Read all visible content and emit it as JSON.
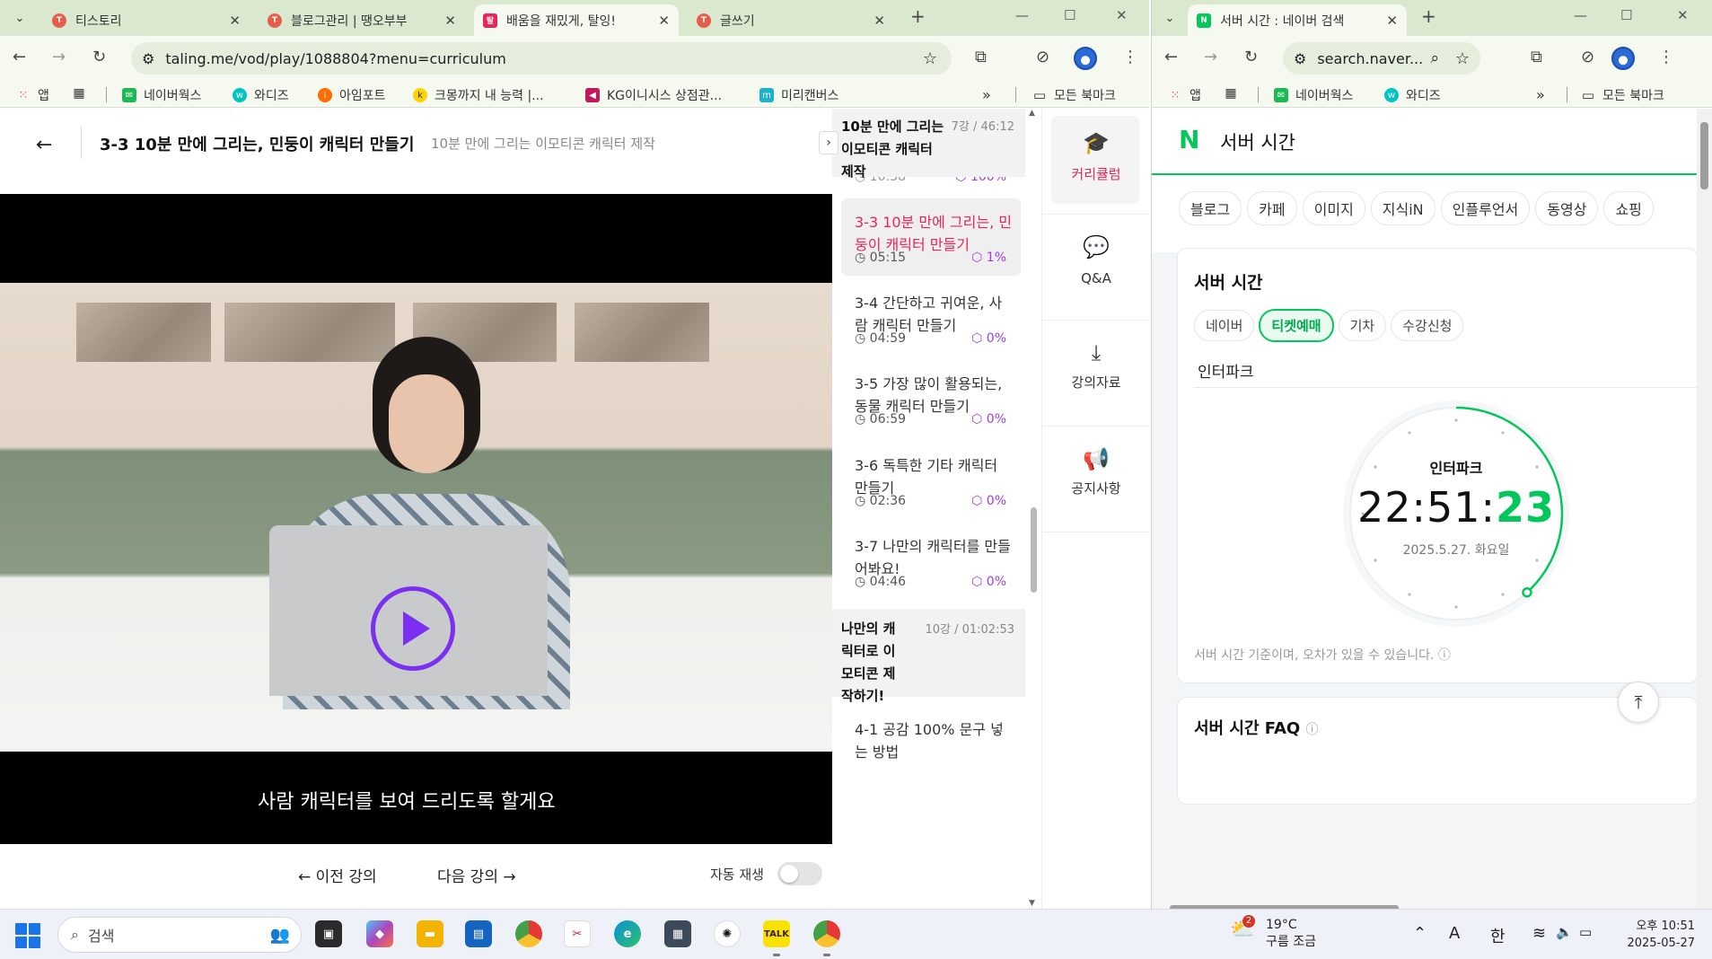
{
  "left_window": {
    "tabs": [
      {
        "title": "티스토리",
        "color": "#e85d4a"
      },
      {
        "title": "블로그관리 | 땡오부부",
        "color": "#e85d4a"
      },
      {
        "title": "배움을 재밌게, 탈잉!",
        "color": "#e8245b"
      },
      {
        "title": "글쓰기",
        "color": "#e85d4a"
      }
    ],
    "url": "taling.me/vod/play/1088804?menu=curriculum",
    "bookmarks": [
      "앱",
      "네이버웍스",
      "와디즈",
      "아임포트",
      "크몽까지 내 능력 |...",
      "KG이니시스 상점관...",
      "미리캔버스"
    ],
    "all_bookmarks": "모든 북마크"
  },
  "lecture": {
    "title": "3-3 10분 만에 그리는, 민둥이 캐릭터 만들기",
    "course": "10분 만에 그리는 이모티콘 캐릭터 제작",
    "subtitle": "사람 캐릭터를 보여 드리도록 할게요",
    "prev": "이전 강의",
    "next": "다음 강의",
    "autoplay": "자동 재생",
    "autoplay_on": false
  },
  "curriculum": {
    "section1": {
      "title": "10분 만에 그리는 이모티콘 캐릭터 제작",
      "meta": "7강 / 46:12"
    },
    "partial_row": {
      "duration": "10:38",
      "progress": "100%"
    },
    "items": [
      {
        "title": "3-3 10분 만에 그리는, 민둥이 캐릭터 만들기",
        "duration": "05:15",
        "progress": "1%"
      },
      {
        "title": "3-4 간단하고 귀여운, 사람 캐릭터 만들기",
        "duration": "04:59",
        "progress": "0%"
      },
      {
        "title": "3-5 가장 많이 활용되는, 동물 캐릭터 만들기",
        "duration": "06:59",
        "progress": "0%"
      },
      {
        "title": "3-6 독특한 기타 캐릭터 만들기",
        "duration": "02:36",
        "progress": "0%"
      },
      {
        "title": "3-7 나만의 캐릭터를 만들어봐요!",
        "duration": "04:46",
        "progress": "0%"
      }
    ],
    "section2": {
      "title": "나만의 캐릭터로 이모티콘 제작하기!",
      "meta": "10강 / 01:02:53"
    },
    "next_item": "4-1 공감 100% 문구 넣는 방법"
  },
  "side_menu": [
    "커리큘럼",
    "Q&A",
    "강의자료",
    "공지사항"
  ],
  "right_window": {
    "tab": "서버 시간 : 네이버 검색",
    "url": "search.naver....",
    "bookmarks": [
      "앱",
      "네이버웍스",
      "와디즈"
    ],
    "all_bookmarks": "모든 북마크",
    "query": "서버 시간",
    "logo": "N",
    "chips": [
      "블로그",
      "카페",
      "이미지",
      "지식iN",
      "인플루언서",
      "동영상",
      "쇼핑"
    ],
    "card_title": "서버 시간",
    "site_tabs": [
      "네이버",
      "티켓예매",
      "기차",
      "수강신청"
    ],
    "selected_site": "인터파크",
    "clock_label": "인터파크",
    "time_hm": "22:51:",
    "time_s": "23",
    "seconds_value": 23,
    "date": "2025.5.27. 화요일",
    "note": "서버 시간 기준이며, 오차가 있을 수 있습니다.",
    "faq": "서버 시간 FAQ"
  },
  "taskbar": {
    "search": "검색",
    "weather_temp": "19°C",
    "weather_desc": "구름 조금",
    "weather_badge": "2",
    "ime": "한",
    "time": "오후 10:51",
    "date": "2025-05-27"
  }
}
